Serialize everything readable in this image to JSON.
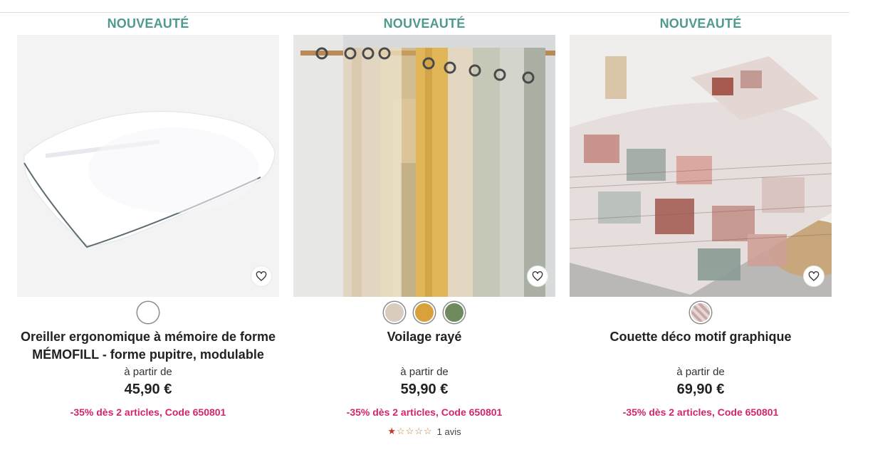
{
  "products": [
    {
      "badge": "NOUVEAUTÉ",
      "image_subject": "white pillow",
      "title_line1": "Oreiller ergonomique à mémoire de forme",
      "title_line2": "MÉMOFILL - forme pupitre, modulable",
      "from_label": "à partir de",
      "price": "45,90 €",
      "promo": "-35% dès 2 articles, Code 650801",
      "swatches": [
        "#ffffff"
      ]
    },
    {
      "badge": "NOUVEAUTÉ",
      "image_subject": "striped sheer curtains",
      "title_line1": "Voilage rayé",
      "title_line2": "",
      "from_label": "à partir de",
      "price": "59,90 €",
      "promo": "-35% dès 2 articles, Code 650801",
      "swatches": [
        "#d9cbbd",
        "#d9a13b",
        "#6f8a5e"
      ],
      "rating": {
        "stars": 1,
        "max": 5,
        "reviews": "1 avis"
      }
    },
    {
      "badge": "NOUVEAUTÉ",
      "image_subject": "patterned duvet on bed",
      "title_line1": "Couette déco motif graphique",
      "title_line2": "",
      "from_label": "à partir de",
      "price": "69,90 €",
      "promo": "-35% dès 2 articles, Code 650801",
      "swatches": [
        "#c7a8a5"
      ]
    }
  ],
  "icons": {
    "favorite": "heart-icon",
    "star": "star-icon"
  },
  "colors": {
    "badge": "#4f9a8f",
    "promo": "#d4246d"
  }
}
